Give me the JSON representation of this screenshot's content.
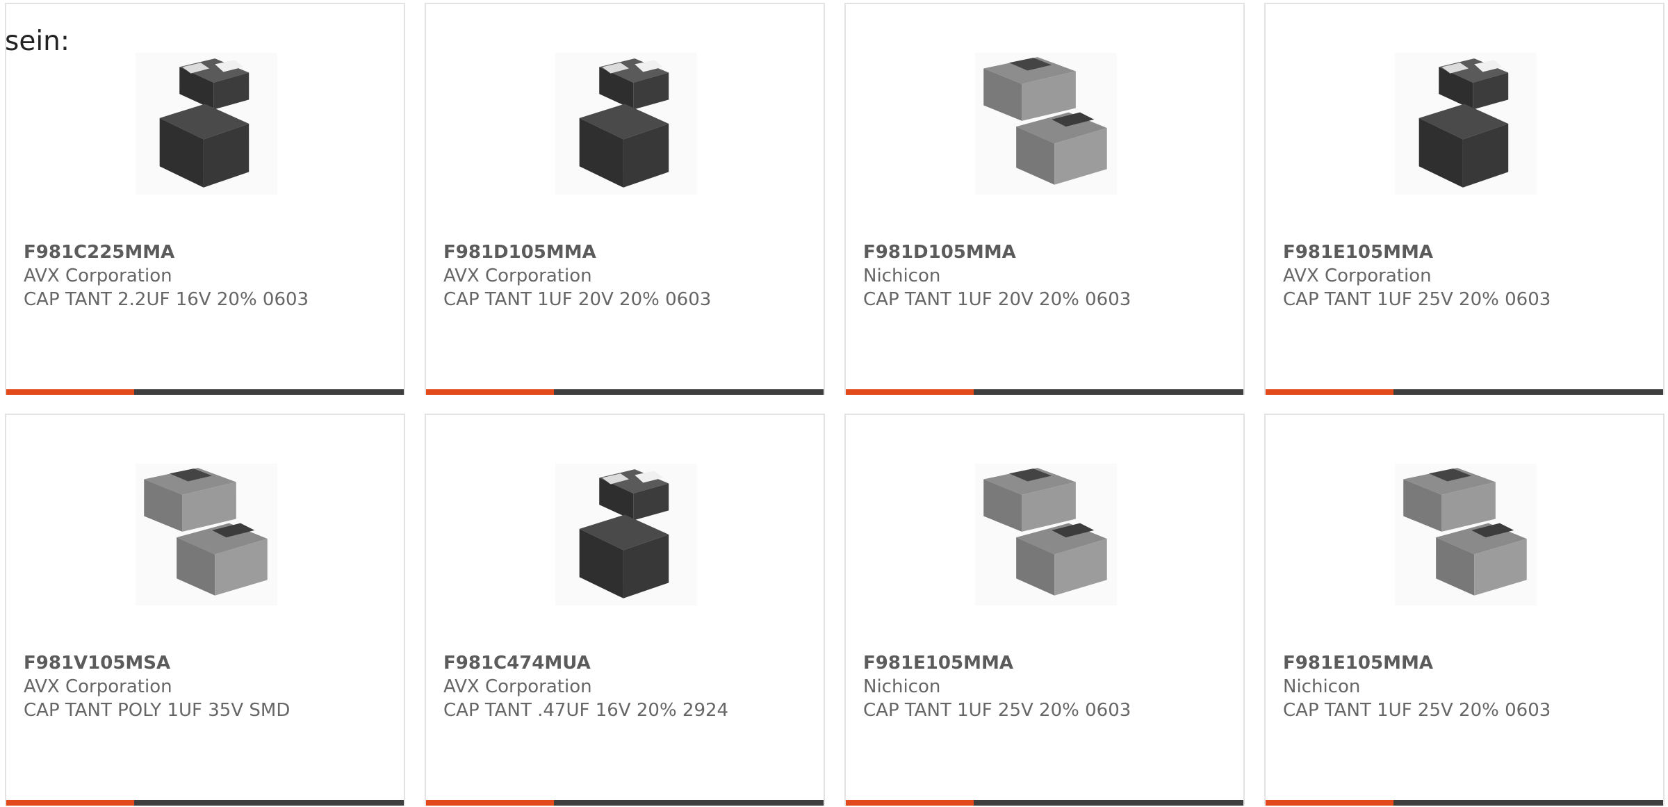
{
  "intro_text": "sein:",
  "colors": {
    "accent_bar": "#e24a1c",
    "dark_bar": "#3e3e3e",
    "card_border": "#e3e3e3",
    "text": "#666666"
  },
  "products": [
    {
      "part_number": "F981C225MMA",
      "manufacturer": "AVX Corporation",
      "description": "CAP TANT 2.2UF 16V 20% 0603",
      "image_style": "dark-single"
    },
    {
      "part_number": "F981D105MMA",
      "manufacturer": "AVX Corporation",
      "description": "CAP TANT 1UF 20V 20% 0603",
      "image_style": "dark-single"
    },
    {
      "part_number": "F981D105MMA",
      "manufacturer": "Nichicon",
      "description": "CAP TANT 1UF 20V 20% 0603",
      "image_style": "grey-pair"
    },
    {
      "part_number": "F981E105MMA",
      "manufacturer": "AVX Corporation",
      "description": "CAP TANT 1UF 25V 20% 0603",
      "image_style": "dark-single"
    },
    {
      "part_number": "F981V105MSA",
      "manufacturer": "AVX Corporation",
      "description": "CAP TANT POLY 1UF 35V SMD",
      "image_style": "grey-pair"
    },
    {
      "part_number": "F981C474MUA",
      "manufacturer": "AVX Corporation",
      "description": "CAP TANT .47UF 16V 20% 2924",
      "image_style": "dark-single"
    },
    {
      "part_number": "F981E105MMA",
      "manufacturer": "Nichicon",
      "description": "CAP TANT 1UF 25V 20% 0603",
      "image_style": "grey-pair"
    },
    {
      "part_number": "F981E105MMA",
      "manufacturer": "Nichicon",
      "description": "CAP TANT 1UF 25V 20% 0603",
      "image_style": "grey-pair"
    }
  ]
}
